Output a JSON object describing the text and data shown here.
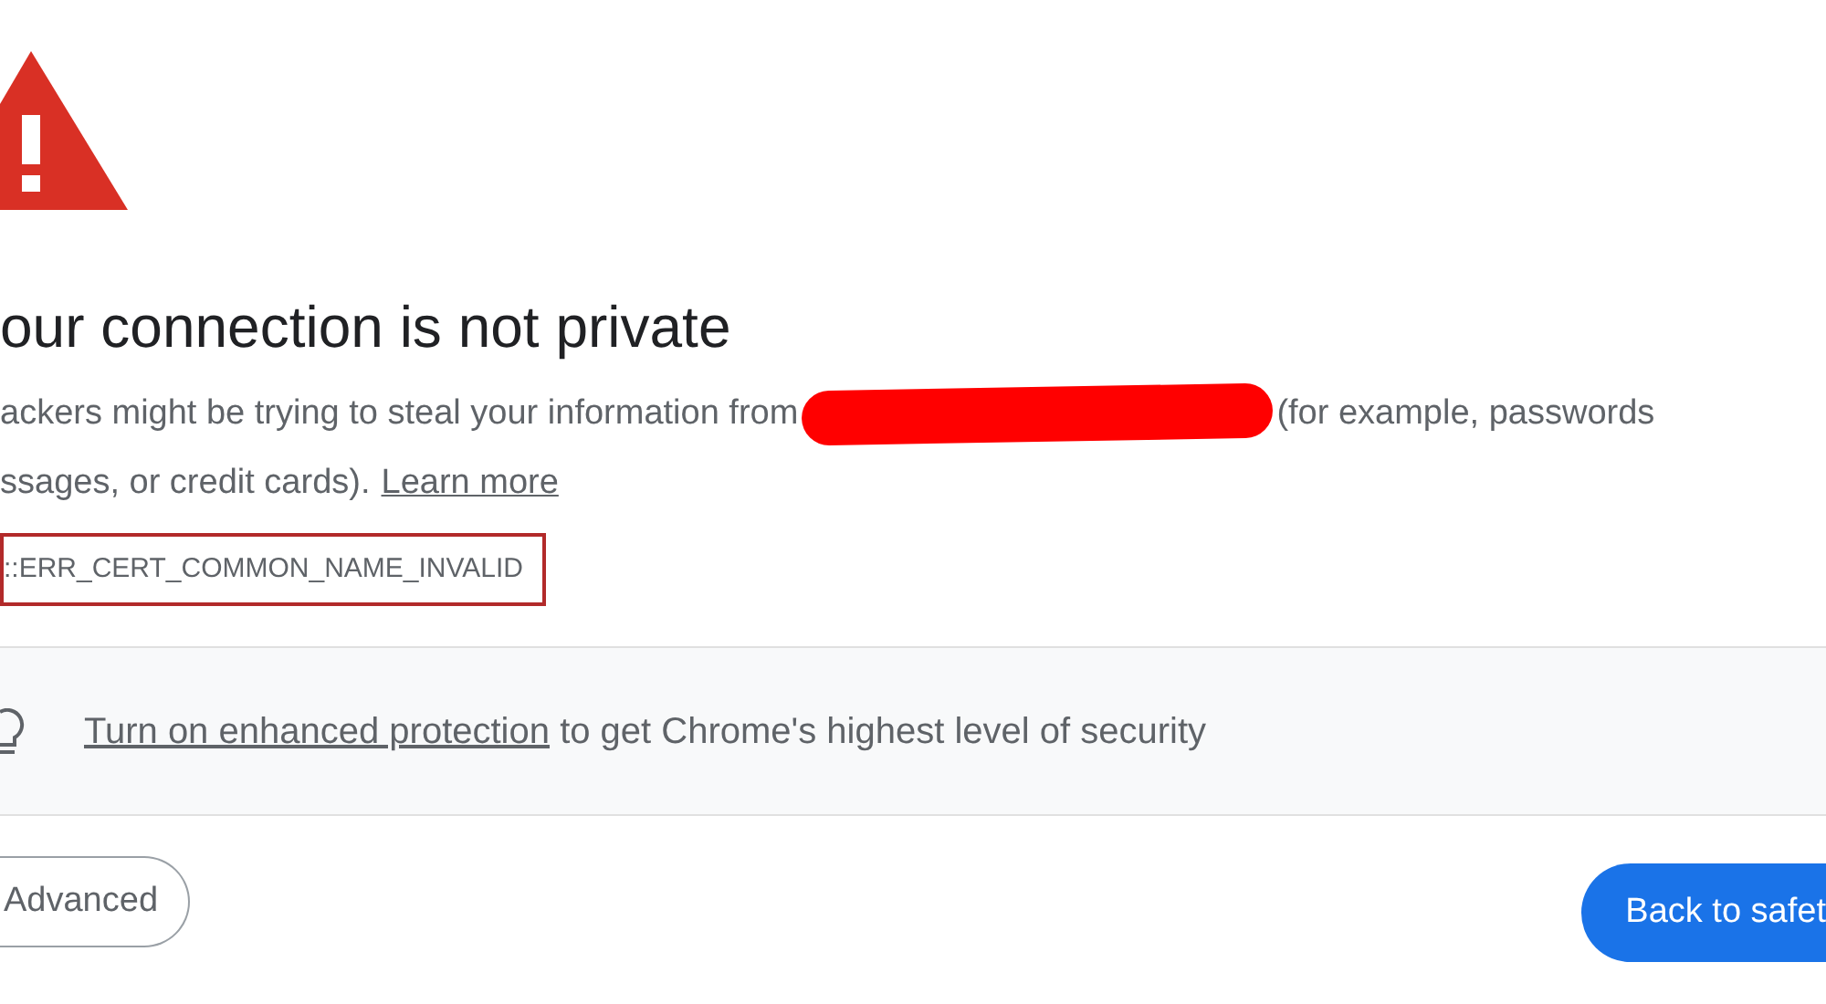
{
  "heading": "our connection is not private",
  "message": {
    "before": "ackers might be trying to steal your information from",
    "after": "(for example, passwords",
    "line_2": "ssages, or credit cards).",
    "link": "Learn more"
  },
  "error_code": "::ERR_CERT_COMMON_NAME_INVALID",
  "banner": {
    "link": "Turn on enhanced protection",
    "text": "to get Chrome's highest level of security"
  },
  "buttons": [
    {
      "kind": "outline",
      "label": "Advanced"
    },
    {
      "kind": "primary",
      "label": "Back to safet"
    }
  ]
}
